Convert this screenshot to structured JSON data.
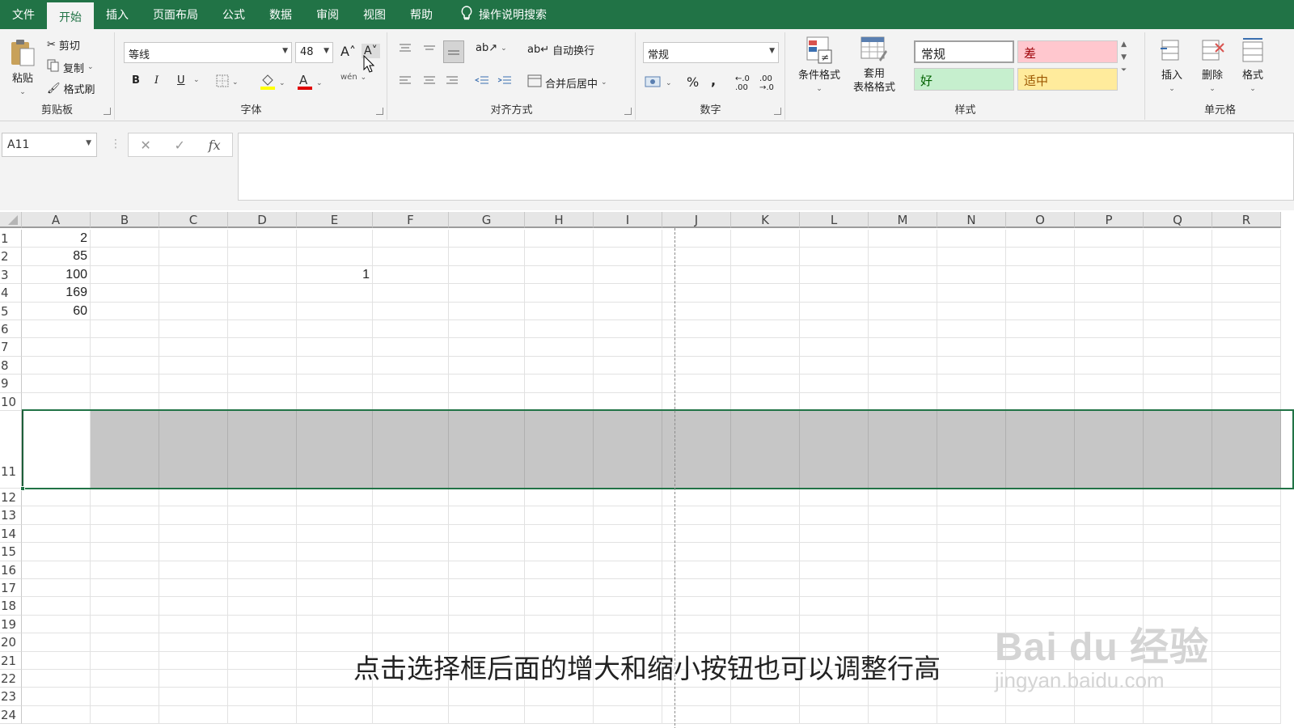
{
  "tabs": [
    "文件",
    "开始",
    "插入",
    "页面布局",
    "公式",
    "数据",
    "审阅",
    "视图",
    "帮助"
  ],
  "tab_search": "操作说明搜索",
  "clipboard": {
    "paste": "粘贴",
    "cut": "剪切",
    "copy": "复制",
    "format_painter": "格式刷",
    "label": "剪贴板"
  },
  "font": {
    "name": "等线",
    "size": "48",
    "label": "字体",
    "bold": "B",
    "italic": "I",
    "underline": "U",
    "phonetic": "wén"
  },
  "alignment": {
    "wrap": "自动换行",
    "merge": "合并后居中",
    "label": "对齐方式"
  },
  "number": {
    "format": "常规",
    "percent": "%",
    "comma": ",",
    "label": "数字"
  },
  "styles": {
    "cond": "条件格式",
    "table_1": "套用",
    "table_2": "表格格式",
    "normal": "常规",
    "bad": "差",
    "good": "好",
    "neutral": "适中",
    "label": "样式"
  },
  "cells": {
    "insert": "插入",
    "delete": "删除",
    "format": "格式",
    "label": "单元格"
  },
  "namebox": "A11",
  "columns": [
    "A",
    "B",
    "C",
    "D",
    "E",
    "F",
    "G",
    "H",
    "I",
    "J",
    "K",
    "L",
    "M",
    "N",
    "O",
    "P",
    "Q",
    "R"
  ],
  "rows": [
    "1",
    "2",
    "3",
    "4",
    "5",
    "6",
    "7",
    "8",
    "9",
    "10",
    "11",
    "12",
    "13",
    "14",
    "15",
    "16",
    "17",
    "18",
    "19",
    "20",
    "21",
    "22",
    "23",
    "24"
  ],
  "cell_values": {
    "A1": "2",
    "A2": "85",
    "A3": "100",
    "A4": "169",
    "A5": "60",
    "E3": "1"
  },
  "subtitle": "点击选择框后面的增大和缩小按钮也可以调整行高",
  "watermark": {
    "brand": "Bai du 经验",
    "url": "jingyan.baidu.com"
  },
  "colors": {
    "accent": "#217346",
    "selected_fill": "#c6c6c6",
    "bad_bg": "#ffc7ce",
    "good_bg": "#c6efce",
    "neutral_bg": "#ffeb9c"
  }
}
